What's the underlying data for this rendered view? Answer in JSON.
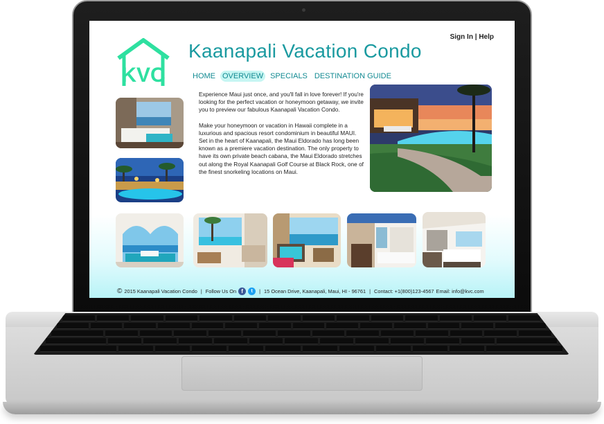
{
  "header": {
    "sign_in": "Sign In",
    "separator": "|",
    "help": "Help",
    "logo_text": "KVC",
    "site_title": "Kaanapali Vacation Condo"
  },
  "nav": {
    "items": [
      {
        "label": "HOME",
        "active": false
      },
      {
        "label": "OVERVIEW",
        "active": true
      },
      {
        "label": "SPECIALS",
        "active": false
      },
      {
        "label": "DESTINATION GUIDE",
        "active": false
      }
    ]
  },
  "content": {
    "paragraph_1": "Experience Maui just once, and you'll fall in love forever! If you're looking for the perfect vacation or honeymoon getaway, we invite you to preview our fabulous Kaanapali Vacation Condo.",
    "paragraph_2": "Make your honeymoon or vacation in Hawaii complete in a luxurious and spacious resort condominium in beautiful MAUI. Set in the heart of Kaanapali, the Maui Eldorado has long been known as a premiere vacation destination. The only property to have its own private beach cabana, the Maui Eldorado stretches out along the Royal Kaanapali Golf Course at Black Rock, one of the finest snorkeling locations on Maui."
  },
  "footer": {
    "copyright_symbol": "©",
    "copyright": "2015 Kaanapali Vacation Condo",
    "follow_label": "Follow Us On",
    "facebook_glyph": "f",
    "twitter_glyph": "t",
    "address": "15 Ocean Drive, Kaanapali, Maui, HI - 96761",
    "contact": "Contact: +1(800)123-4567",
    "email": "Email: info@kvc.com",
    "divider": "|"
  },
  "colors": {
    "brand_teal": "#1a9aa0",
    "logo_green": "#2ee0a0",
    "nav_active_bg": "#c7f6f3"
  },
  "icons": [
    "kvc-logo",
    "facebook-icon",
    "twitter-icon",
    "copyright-icon"
  ]
}
